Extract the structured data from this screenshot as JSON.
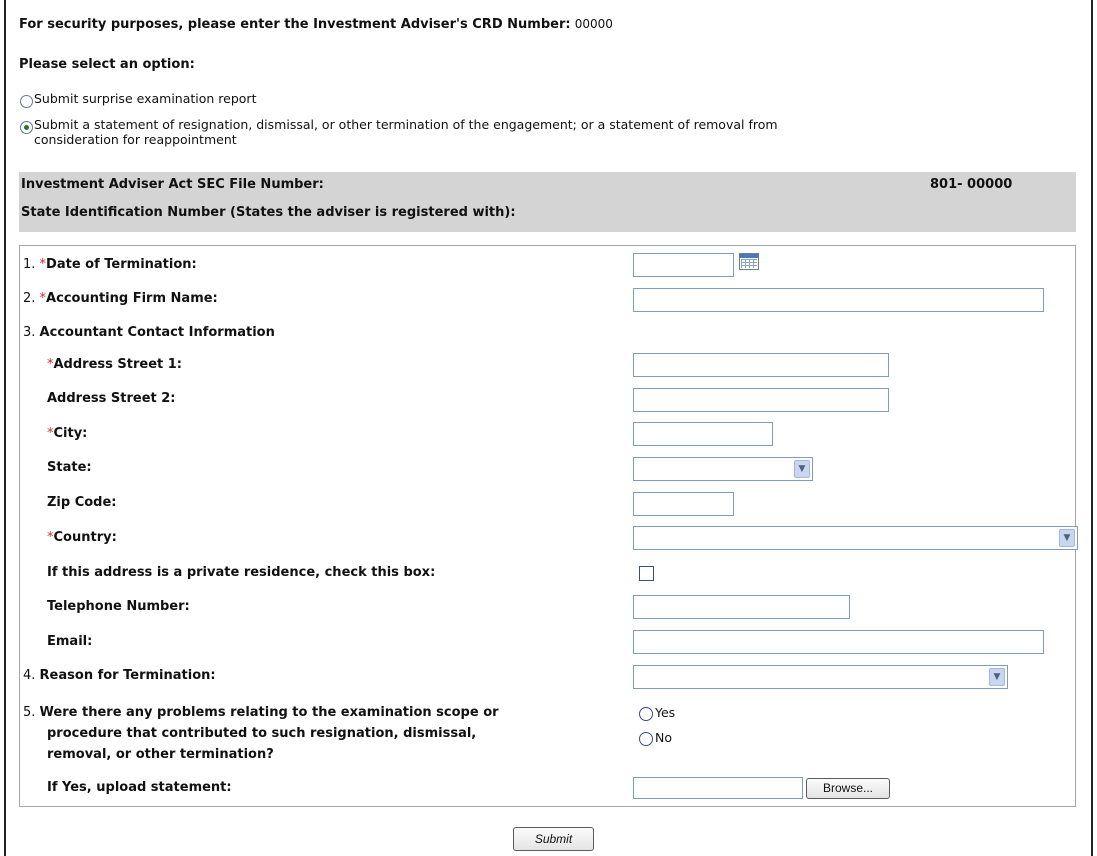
{
  "security": {
    "prompt": "For security purposes, please enter the Investment Adviser's CRD Number:",
    "crd_number": "00000"
  },
  "options": {
    "heading": "Please select an option:",
    "option1_label": "Submit surprise examination report",
    "option2_label_line1": "Submit a statement of resignation, dismissal, or other termination of the engagement; or a statement of removal from",
    "option2_label_line2": "consideration for reappointment",
    "selected": "option2"
  },
  "info_bar": {
    "sec_file_label": "Investment Adviser Act SEC File Number:",
    "sec_file_value": "801- 00000",
    "state_id_label": "State Identification Number (States the adviser is registered with):"
  },
  "form": {
    "q1": {
      "num": "1.",
      "req": "*",
      "label": "Date of Termination:",
      "value": ""
    },
    "q2": {
      "num": "2.",
      "req": "*",
      "label": "Accounting Firm Name:",
      "value": ""
    },
    "q3": {
      "num": "3.",
      "label": "Accountant Contact Information"
    },
    "street1": {
      "req": "*",
      "label": "Address Street 1:",
      "value": ""
    },
    "street2": {
      "label": "Address Street 2:",
      "value": ""
    },
    "city": {
      "req": "*",
      "label": "City:",
      "value": ""
    },
    "state": {
      "label": "State:",
      "value": ""
    },
    "zip": {
      "label": "Zip Code:",
      "value": ""
    },
    "country": {
      "req": "*",
      "label": "Country:",
      "value": ""
    },
    "private_residence": {
      "label": "If this address is a private residence, check this box:",
      "checked": false
    },
    "telephone": {
      "label": "Telephone Number:",
      "value": ""
    },
    "email": {
      "label": "Email:",
      "value": ""
    },
    "q4": {
      "num": "4.",
      "label": "Reason for Termination:",
      "value": ""
    },
    "q5": {
      "num": "5.",
      "label_line1": "Were there any problems relating to the examination scope or",
      "label_line2": "procedure that contributed to such resignation, dismissal,",
      "label_line3": "removal, or other termination?",
      "yes_label": "Yes",
      "no_label": "No"
    },
    "upload": {
      "label": "If Yes, upload statement:",
      "value": "",
      "browse_label": "Browse..."
    }
  },
  "submit_label": "Submit",
  "colors": {
    "required": "#d22a2a",
    "info_bar_bg": "#d4d4d4",
    "input_border": "#7f9db9"
  },
  "icons": {
    "date_picker": "calendar-icon",
    "dropdown": "chevron-down-icon"
  }
}
